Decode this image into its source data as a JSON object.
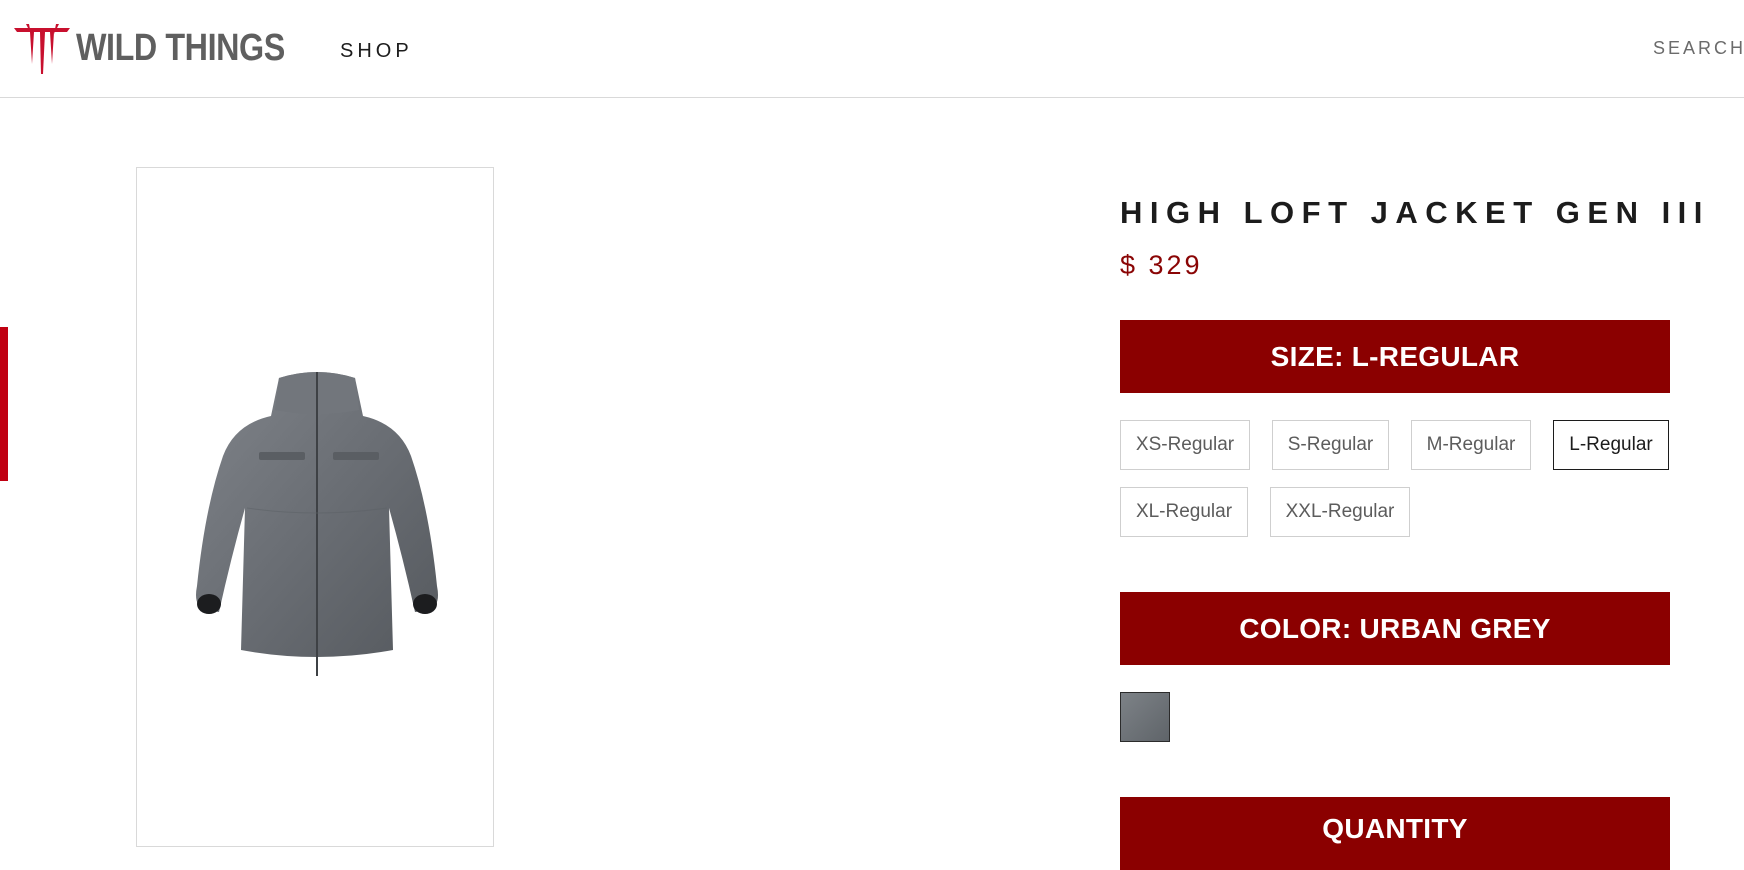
{
  "header": {
    "brand": "WILD THINGS",
    "nav_shop": "SHOP",
    "nav_search": "SEARCH"
  },
  "product": {
    "title": "HIGH LOFT JACKET GEN III",
    "price": "$ 329",
    "image_alt_icon": "jacket-photo"
  },
  "size": {
    "heading": "SIZE: L-REGULAR",
    "options": [
      "XS-Regular",
      "S-Regular",
      "M-Regular",
      "L-Regular",
      "XL-Regular",
      "XXL-Regular"
    ],
    "selected": "L-Regular"
  },
  "color": {
    "heading": "COLOR: URBAN GREY",
    "swatch_color": "#6b7075"
  },
  "quantity": {
    "heading": "QUANTITY"
  },
  "theme": {
    "accent": "#8b0000",
    "price_color": "#8a0505",
    "side_tab": "#c00012"
  }
}
